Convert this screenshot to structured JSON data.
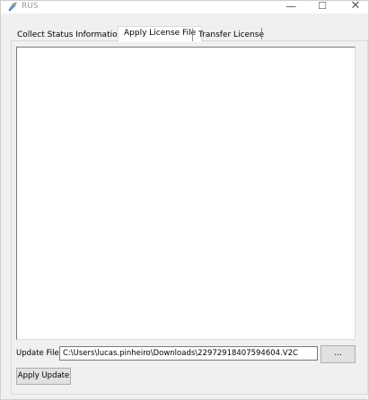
{
  "window": {
    "title": "RUS",
    "controls": {
      "minimize": "—",
      "maximize": "☐",
      "close": "✕"
    },
    "icon": "rus-app-icon"
  },
  "tabs": [
    {
      "label": "Collect Status Information",
      "selected": false
    },
    {
      "label": "Apply License File",
      "selected": true
    },
    {
      "label": "Transfer License",
      "selected": false
    }
  ],
  "form": {
    "update_file_label": "Update File",
    "update_file_value": "C:\\Users\\lucas.pinheiro\\Downloads\\22972918407594604.V2C",
    "browse_label": "...",
    "apply_button_label": "Apply Update"
  }
}
